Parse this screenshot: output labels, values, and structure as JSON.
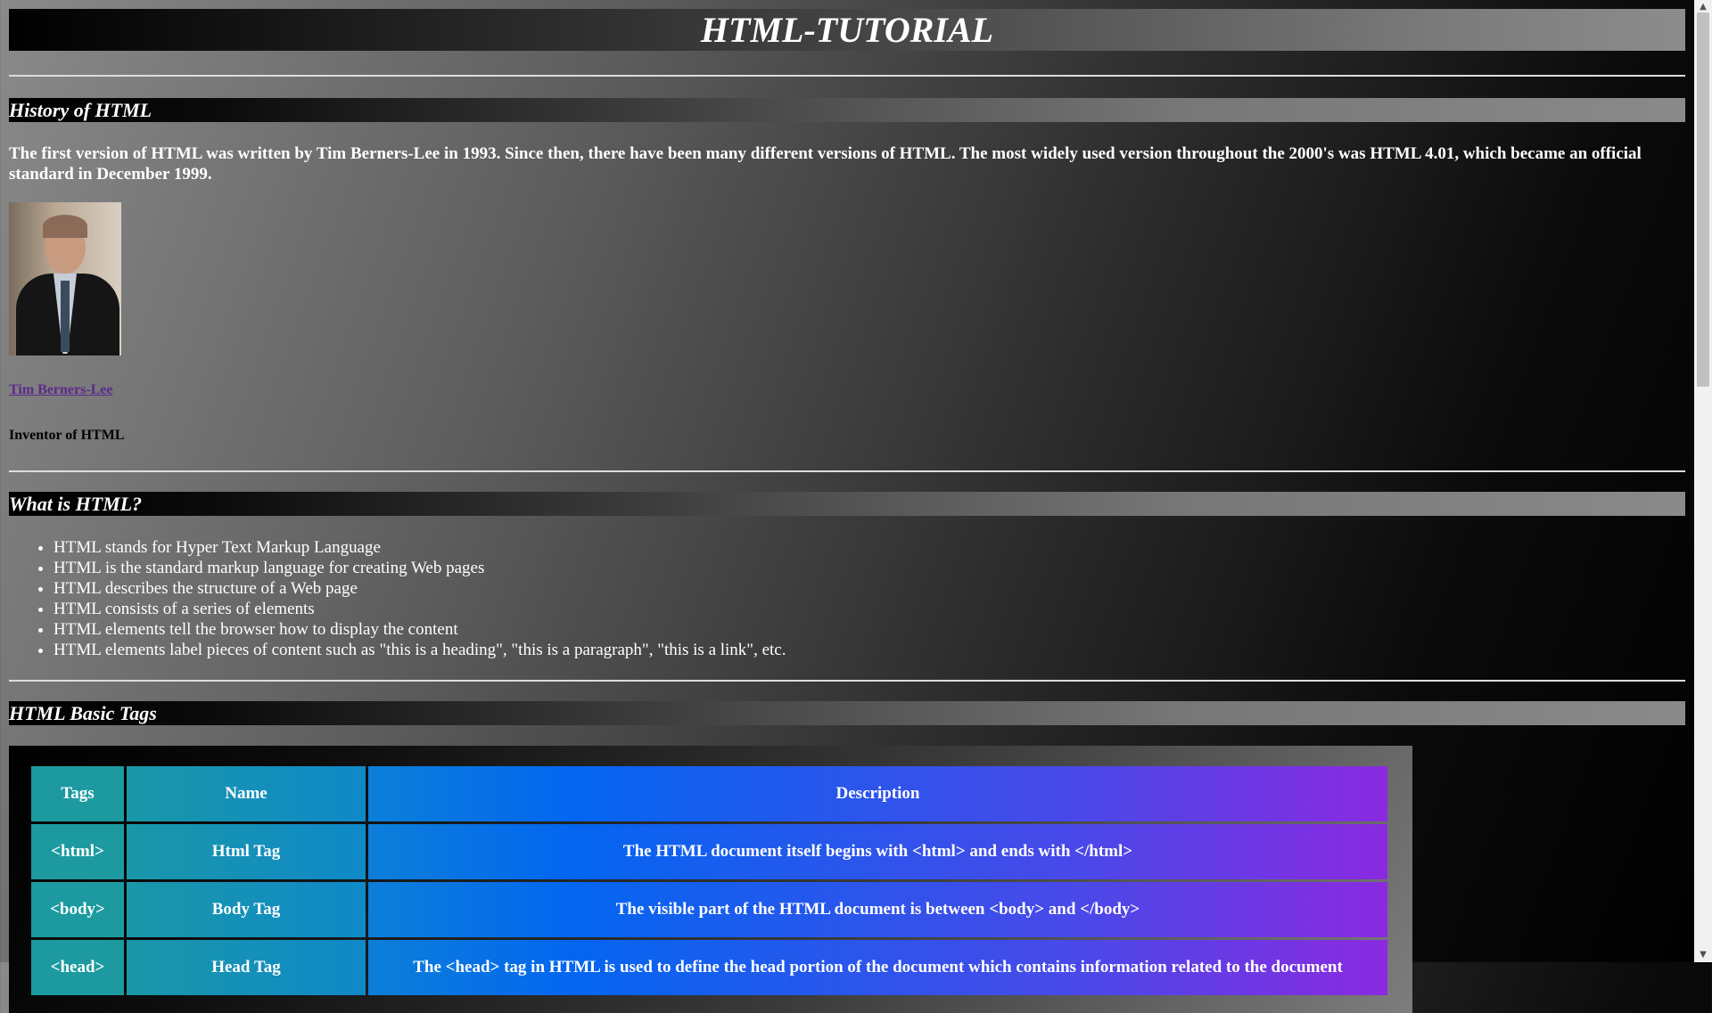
{
  "page": {
    "title": "HTML-TUTORIAL"
  },
  "history": {
    "heading": "History of HTML",
    "paragraph": "The first version of HTML was written by Tim Berners-Lee in 1993. Since then, there have been many different versions of HTML. The most widely used version throughout the 2000's was HTML 4.01, which became an official standard in December 1999.",
    "link_text": "Tim Berners-Lee",
    "caption": "Inventor of HTML"
  },
  "what_is": {
    "heading": "What is HTML?",
    "items": [
      "HTML stands for Hyper Text Markup Language",
      "HTML is the standard markup language for creating Web pages",
      "HTML describes the structure of a Web page",
      "HTML consists of a series of elements",
      "HTML elements tell the browser how to display the content",
      "HTML elements label pieces of content such as \"this is a heading\", \"this is a paragraph\", \"this is a link\", etc."
    ]
  },
  "basic_tags": {
    "heading": "HTML Basic Tags",
    "headers": [
      "Tags",
      "Name",
      "Description"
    ],
    "rows": [
      [
        "<html>",
        "Html Tag",
        "The HTML document itself begins with <html> and ends with </html>"
      ],
      [
        "<body>",
        "Body Tag",
        "The visible part of the HTML document is between <body> and </body>"
      ],
      [
        "<head>",
        "Head Tag",
        "The <head> tag in HTML is used to define the head portion of the document which contains information related to the document"
      ]
    ]
  },
  "icons": {
    "scroll_up": "up-arrow-icon",
    "scroll_down": "down-arrow-icon"
  }
}
